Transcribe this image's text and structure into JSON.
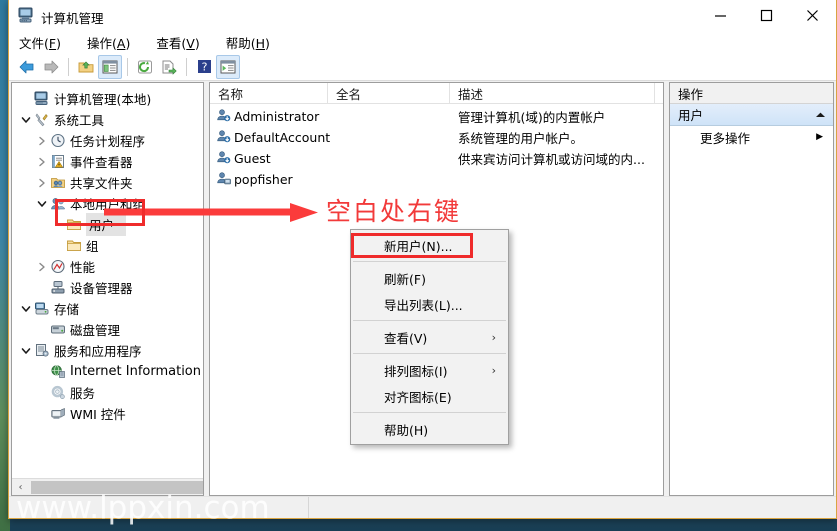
{
  "window": {
    "title": "计算机管理",
    "icon": "computer-management-icon",
    "buttons": {
      "minimize": "—",
      "maximize": "☐",
      "close": "✕"
    }
  },
  "menubar": [
    {
      "label": "文件",
      "accel": "F"
    },
    {
      "label": "操作",
      "accel": "A"
    },
    {
      "label": "查看",
      "accel": "V"
    },
    {
      "label": "帮助",
      "accel": "H"
    }
  ],
  "toolbar": [
    {
      "name": "back-arrow-icon",
      "pressed": false
    },
    {
      "name": "forward-arrow-icon",
      "pressed": false
    },
    {
      "name": "separator"
    },
    {
      "name": "up-folder-icon",
      "pressed": false
    },
    {
      "name": "show-hide-tree-icon",
      "pressed": true
    },
    {
      "name": "separator"
    },
    {
      "name": "refresh-icon",
      "pressed": false
    },
    {
      "name": "export-list-icon",
      "pressed": false
    },
    {
      "name": "separator"
    },
    {
      "name": "help-icon",
      "pressed": false
    },
    {
      "name": "show-action-pane-icon",
      "pressed": true
    }
  ],
  "tree": {
    "nodes": [
      {
        "label": "计算机管理(本地)",
        "depth": 0,
        "twisty": "",
        "icon": "computer-icon"
      },
      {
        "label": "系统工具",
        "depth": 1,
        "twisty": "expanded",
        "icon": "system-tools-icon"
      },
      {
        "label": "任务计划程序",
        "depth": 2,
        "twisty": "collapsed",
        "icon": "task-scheduler-icon"
      },
      {
        "label": "事件查看器",
        "depth": 2,
        "twisty": "collapsed",
        "icon": "event-viewer-icon"
      },
      {
        "label": "共享文件夹",
        "depth": 2,
        "twisty": "collapsed",
        "icon": "shared-folders-icon"
      },
      {
        "label": "本地用户和组",
        "depth": 2,
        "twisty": "expanded",
        "icon": "local-users-groups-icon"
      },
      {
        "label": "用户",
        "depth": 3,
        "twisty": "",
        "icon": "folder-icon",
        "selected": true
      },
      {
        "label": "组",
        "depth": 3,
        "twisty": "",
        "icon": "folder-icon"
      },
      {
        "label": "性能",
        "depth": 2,
        "twisty": "collapsed",
        "icon": "performance-icon"
      },
      {
        "label": "设备管理器",
        "depth": 2,
        "twisty": "",
        "icon": "device-manager-icon"
      },
      {
        "label": "存储",
        "depth": 1,
        "twisty": "expanded",
        "icon": "storage-icon"
      },
      {
        "label": "磁盘管理",
        "depth": 2,
        "twisty": "",
        "icon": "disk-management-icon"
      },
      {
        "label": "服务和应用程序",
        "depth": 1,
        "twisty": "expanded",
        "icon": "services-apps-icon"
      },
      {
        "label": "Internet Information S",
        "depth": 2,
        "twisty": "",
        "icon": "iis-icon"
      },
      {
        "label": "服务",
        "depth": 2,
        "twisty": "",
        "icon": "services-icon"
      },
      {
        "label": "WMI 控件",
        "depth": 2,
        "twisty": "",
        "icon": "wmi-control-icon"
      }
    ],
    "scrollbar": {
      "left_arrow": "‹",
      "right_arrow": "›"
    }
  },
  "list": {
    "columns": [
      {
        "label": "名称"
      },
      {
        "label": "全名"
      },
      {
        "label": "描述"
      },
      {
        "label": ""
      }
    ],
    "rows": [
      {
        "icon": "user-account-icon",
        "name": "Administrator",
        "fullname": "",
        "description": "管理计算机(域)的内置帐户"
      },
      {
        "icon": "user-account-icon",
        "name": "DefaultAccount",
        "fullname": "",
        "description": "系统管理的用户帐户。"
      },
      {
        "icon": "user-account-icon",
        "name": "Guest",
        "fullname": "",
        "description": "供来宾访问计算机或访问域的内..."
      },
      {
        "icon": "user-local-icon",
        "name": "popfisher",
        "fullname": "",
        "description": ""
      }
    ]
  },
  "actions": {
    "title": "操作",
    "group_label": "用户",
    "group_collapse_icon": "chevron-up-icon",
    "items": [
      {
        "label": "更多操作",
        "submenu_arrow": "▶"
      }
    ]
  },
  "context_menu": {
    "items": [
      {
        "label": "新用户(N)...",
        "highlighted": true,
        "type": "item"
      },
      {
        "type": "separator"
      },
      {
        "label": "刷新(F)",
        "type": "item"
      },
      {
        "label": "导出列表(L)...",
        "type": "item"
      },
      {
        "type": "separator"
      },
      {
        "label": "查看(V)",
        "type": "item",
        "submenu": "›"
      },
      {
        "type": "separator"
      },
      {
        "label": "排列图标(I)",
        "type": "item",
        "submenu": "›"
      },
      {
        "label": "对齐图标(E)",
        "type": "item"
      },
      {
        "type": "separator"
      },
      {
        "label": "帮助(H)",
        "type": "item"
      }
    ]
  },
  "annotations": {
    "text": "空白处右键",
    "color": "#f23a3a",
    "arrow": "red-arrow-right",
    "highlight_tree": "red-rect-around-users-node",
    "highlight_menu": "red-rect-around-new-user-item"
  },
  "watermark": "www.lppxin.com",
  "statusbar": {
    "left": "",
    "right": ""
  }
}
